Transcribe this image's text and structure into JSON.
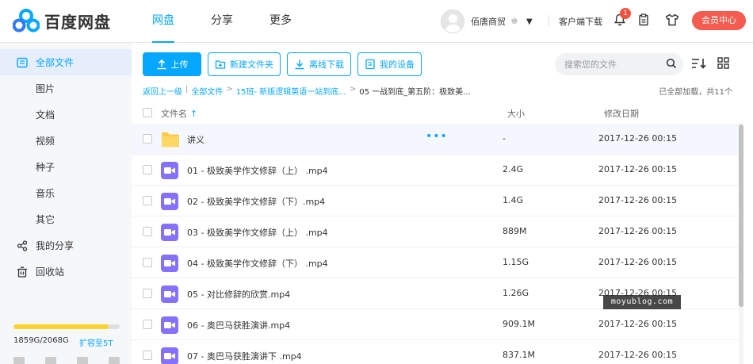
{
  "app": {
    "logo_text": "百度网盘"
  },
  "nav": {
    "items": [
      "网盘",
      "分享",
      "更多"
    ],
    "active": 0
  },
  "user": {
    "name": "佰唐商贸",
    "client_download": "客户端下载",
    "notification_count": "1",
    "vip_center": "会员中心"
  },
  "sidebar": {
    "items": [
      {
        "label": "全部文件",
        "icon": "folder-list-icon",
        "active": true
      },
      {
        "label": "图片"
      },
      {
        "label": "文档"
      },
      {
        "label": "视频"
      },
      {
        "label": "种子"
      },
      {
        "label": "音乐"
      },
      {
        "label": "其它"
      },
      {
        "label": "我的分享",
        "icon": "share-icon"
      },
      {
        "label": "回收站",
        "icon": "trash-icon"
      }
    ],
    "quota": {
      "used_text": "1859G/2068G",
      "upgrade": "扩容至5T",
      "fraction": 0.899
    }
  },
  "toolbar": {
    "upload": "上传",
    "new_folder": "新建文件夹",
    "offline_download": "离线下载",
    "my_devices": "我的设备"
  },
  "search": {
    "placeholder": "搜索您的文件"
  },
  "breadcrumb": {
    "back": "返回上一级",
    "items": [
      "全部文件",
      "15班- 新版逻辑英语一站到底...",
      "05 一战到底_第五阶：极致美..."
    ]
  },
  "loaded_text": "已全部加载，共11个",
  "table": {
    "headers": {
      "name": "文件名",
      "size": "大小",
      "date": "修改日期"
    },
    "rows": [
      {
        "name": "讲义",
        "size": "-",
        "date": "2017-12-26 00:15",
        "type": "folder"
      },
      {
        "name": "01 - 极致美学作文修辞（上） .mp4",
        "size": "2.4G",
        "date": "2017-12-26 00:15",
        "type": "video"
      },
      {
        "name": "02 - 极致美学作文修辞（下）.mp4",
        "size": "1.4G",
        "date": "2017-12-26 00:15",
        "type": "video"
      },
      {
        "name": "03 - 极致美学作文修辞（上） .mp4",
        "size": "889M",
        "date": "2017-12-26 00:15",
        "type": "video"
      },
      {
        "name": "04 - 极致美学作文修辞（下） .mp4",
        "size": "1.15G",
        "date": "2017-12-26 00:15",
        "type": "video"
      },
      {
        "name": "05 - 对比修辞的欣赏.mp4",
        "size": "1.26G",
        "date": "2017-12-26 00:15",
        "type": "video"
      },
      {
        "name": "06 - 奥巴马获胜演讲.mp4",
        "size": "909.1M",
        "date": "2017-12-26 00:15",
        "type": "video"
      },
      {
        "name": "07 - 奥巴马获胜演讲下 .mp4",
        "size": "837.1M",
        "date": "2017-12-26 00:15",
        "type": "video"
      }
    ]
  },
  "watermark": "moyublog.com",
  "colors": {
    "accent": "#06a7ff",
    "vip": "#f45c4f",
    "quota": "#fed32f",
    "video": "#8472ff",
    "folder": "#fcc94a"
  }
}
